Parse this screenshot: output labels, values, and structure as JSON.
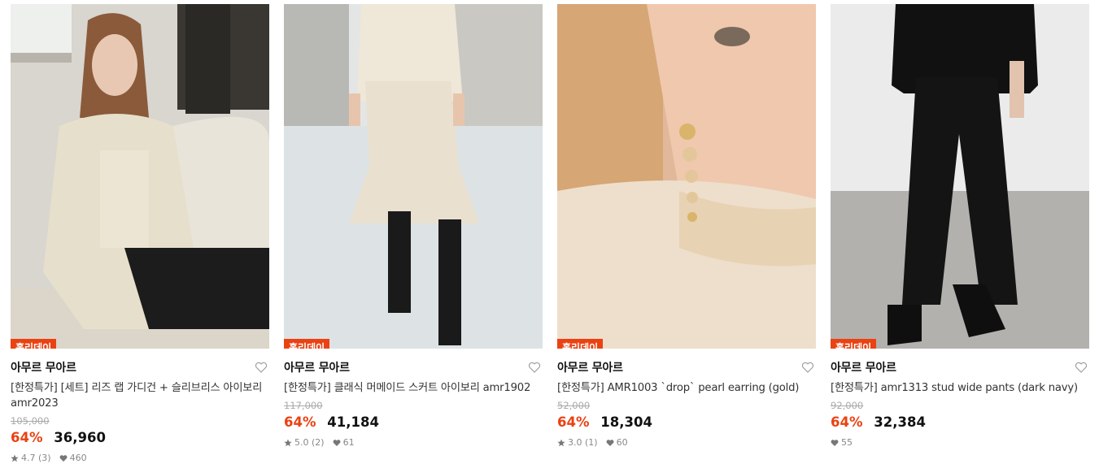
{
  "products": [
    {
      "badge": "홀리데이",
      "brand": "아무르 무아르",
      "name": "[한정특가] [세트] 리즈 랩 가디건 + 슬리브리스 아이보리 amr2023",
      "original_price": "105,000",
      "discount": "64%",
      "price": "36,960",
      "rating": "4.7 (3)",
      "likes": "460"
    },
    {
      "badge": "홀리데이",
      "brand": "아무르 무아르",
      "name": "[한정특가] 클래식 머메이드 스커트 아이보리 amr1902",
      "original_price": "117,000",
      "discount": "64%",
      "price": "41,184",
      "rating": "5.0 (2)",
      "likes": "61"
    },
    {
      "badge": "홀리데이",
      "brand": "아무르 무아르",
      "name": "[한정특가] AMR1003 `drop` pearl earring (gold)",
      "original_price": "52,000",
      "discount": "64%",
      "price": "18,304",
      "rating": "3.0 (1)",
      "likes": "60"
    },
    {
      "badge": "홀리데이",
      "brand": "아무르 무아르",
      "name": "[한정특가] amr1313 stud wide pants (dark navy)",
      "original_price": "92,000",
      "discount": "64%",
      "price": "32,384",
      "likes": "55"
    }
  ],
  "colors": {
    "accent": "#ea4212",
    "muted": "#aaaaaa"
  }
}
